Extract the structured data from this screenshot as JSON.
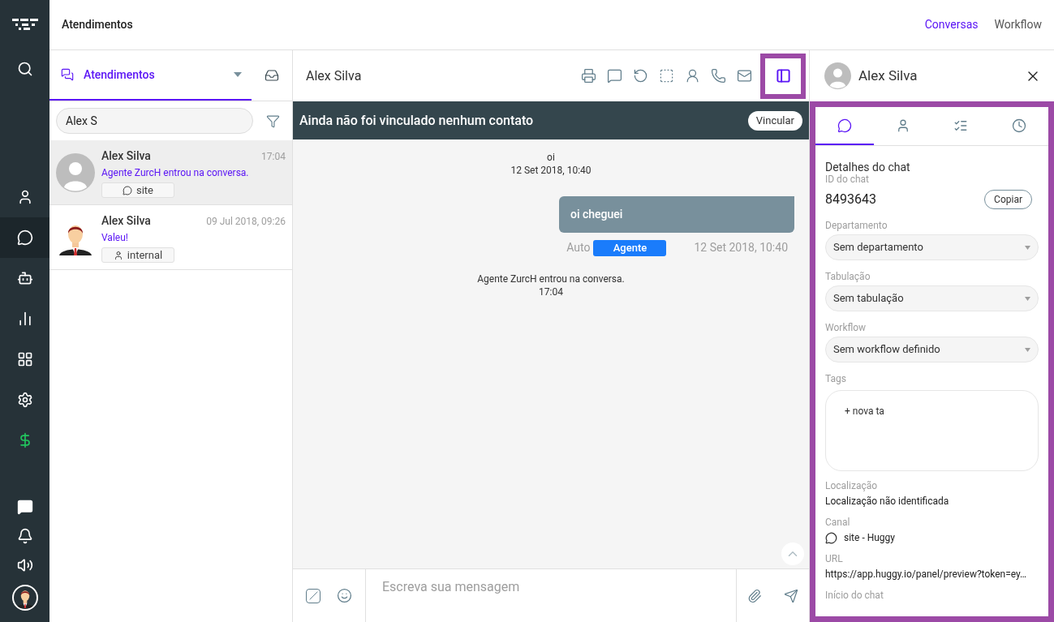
{
  "nav": {
    "top": [
      {
        "kind": "search",
        "selected": false
      }
    ],
    "middle": [
      {
        "kind": "contacts",
        "selected": false
      },
      {
        "kind": "chats",
        "selected": true
      },
      {
        "kind": "bot",
        "selected": false
      },
      {
        "kind": "reports",
        "selected": false
      },
      {
        "kind": "apps",
        "selected": false
      },
      {
        "kind": "settings",
        "selected": false
      },
      {
        "kind": "billing",
        "selected": false
      }
    ],
    "bottom": [
      {
        "kind": "messages",
        "selected": false
      },
      {
        "kind": "notifications",
        "selected": false
      },
      {
        "kind": "sound",
        "selected": false
      },
      {
        "kind": "profile",
        "selected": false
      }
    ]
  },
  "header": {
    "title": "Atendimentos",
    "links": [
      {
        "label": "Conversas",
        "selected": true
      },
      {
        "label": "Workflow",
        "selected": false
      }
    ]
  },
  "list_panel": {
    "tab": {
      "label": "Atendimentos",
      "selected": true
    },
    "search": {
      "value": "Alex S"
    },
    "conversations": [
      {
        "name": "Alex Silva",
        "preview": "Agente ZurcH entrou na conversa.",
        "time": "17:04",
        "channel": {
          "kind": "site",
          "label": "site"
        },
        "avatar": {
          "kind": "placeholder"
        },
        "selected": true
      },
      {
        "name": "Alex Silva",
        "preview": "Valeu!",
        "time": "09 Jul 2018, 09:26",
        "channel": {
          "kind": "internal",
          "label": "internal"
        },
        "avatar": {
          "kind": "illustration"
        },
        "selected": false
      }
    ]
  },
  "chat": {
    "title": "Alex Silva",
    "toolbar": [
      {
        "kind": "print",
        "selected": false
      },
      {
        "kind": "resolve",
        "selected": false
      },
      {
        "kind": "reopen",
        "selected": false
      },
      {
        "kind": "select",
        "selected": false
      },
      {
        "kind": "transfer",
        "selected": false
      },
      {
        "kind": "call",
        "selected": false
      },
      {
        "kind": "email",
        "selected": false
      },
      {
        "kind": "panel",
        "selected": true
      }
    ],
    "banner": {
      "text": "Ainda não foi vinculado nenhum contato",
      "button": "Vincular"
    },
    "messages": [
      {
        "kind": "system",
        "text": "oi",
        "time": "12 Set 2018, 10:40"
      },
      {
        "kind": "outgoing",
        "text": "oi cheguei",
        "sender": "Auto",
        "badge": "Agente",
        "time": "12 Set 2018, 10:40"
      },
      {
        "kind": "system",
        "text": "Agente ZurcH entrou na conversa.",
        "time": "17:04"
      }
    ],
    "composer": {
      "placeholder": "Escreva sua mensagem"
    }
  },
  "details": {
    "name": "Alex Silva",
    "tabs": [
      {
        "kind": "chat",
        "selected": true
      },
      {
        "kind": "contact",
        "selected": false
      },
      {
        "kind": "list",
        "selected": false
      },
      {
        "kind": "history",
        "selected": false
      }
    ],
    "heading": "Detalhes do chat",
    "id_label": "ID do chat",
    "id_value": "8493643",
    "copy_button": "Copiar",
    "selects": [
      {
        "label": "Departamento",
        "value": "Sem departamento"
      },
      {
        "label": "Tabulação",
        "value": "Sem tabulação"
      },
      {
        "label": "Workflow",
        "value": "Sem workflow definido"
      }
    ],
    "tags": {
      "label": "Tags",
      "placeholder": "+ nova ta"
    },
    "fields": [
      {
        "kind": "text",
        "label": "Localização",
        "value": "Localização não identificada"
      },
      {
        "kind": "channel",
        "label": "Canal",
        "value": "site - Huggy"
      },
      {
        "kind": "text",
        "label": "URL",
        "value": "https://app.huggy.io/panel/preview?token=ey…"
      },
      {
        "kind": "label",
        "label": "Início do chat"
      }
    ]
  }
}
